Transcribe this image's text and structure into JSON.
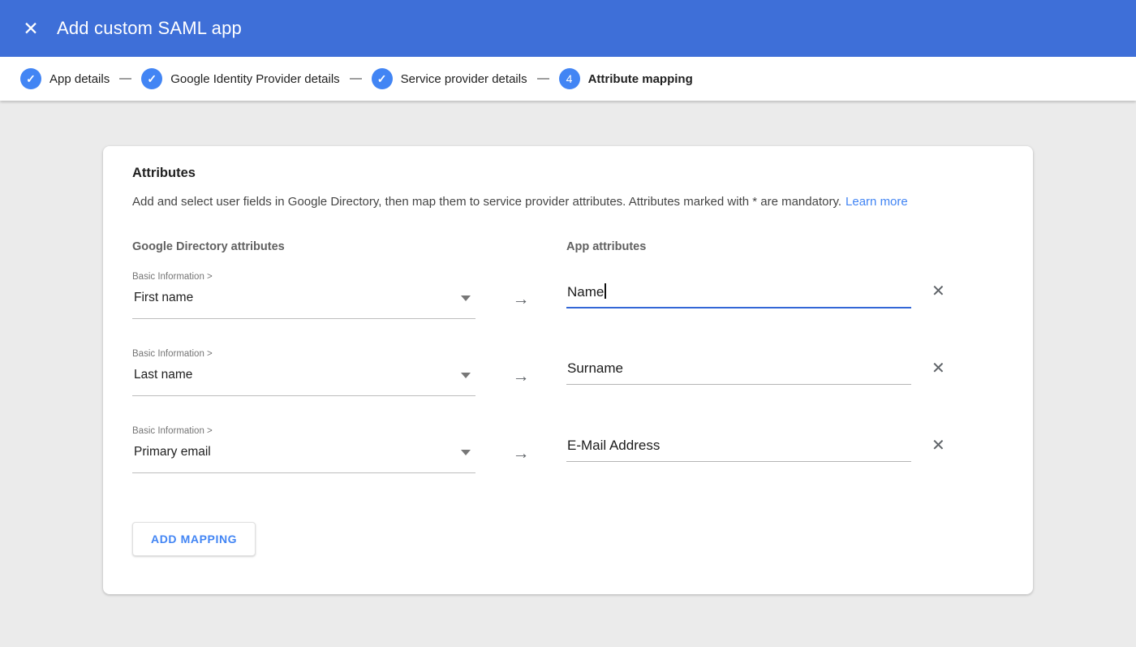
{
  "header": {
    "title": "Add custom SAML app"
  },
  "icons": {
    "close": "✕",
    "check": "✓",
    "arrow_right": "→",
    "delete": "✕"
  },
  "stepper": {
    "steps": [
      {
        "label": "App details",
        "state": "complete"
      },
      {
        "label": "Google Identity Provider details",
        "state": "complete"
      },
      {
        "label": "Service provider details",
        "state": "complete"
      },
      {
        "label": "Attribute mapping",
        "state": "current",
        "number": "4"
      }
    ]
  },
  "card": {
    "section_title": "Attributes",
    "description": "Add and select user fields in Google Directory, then map them to service provider attributes. Attributes marked with * are mandatory.",
    "learn_more_label": "Learn more",
    "columns": {
      "left": "Google Directory attributes",
      "right": "App attributes"
    },
    "mappings": [
      {
        "category": "Basic Information >",
        "field": "First name",
        "app_value": "Name",
        "focused": true
      },
      {
        "category": "Basic Information >",
        "field": "Last name",
        "app_value": "Surname",
        "focused": false
      },
      {
        "category": "Basic Information >",
        "field": "Primary email",
        "app_value": "E-Mail Address",
        "focused": false
      }
    ],
    "add_mapping_label": "ADD MAPPING"
  },
  "colors": {
    "header_bg": "#3e6fd8",
    "step_circle": "#4285f4",
    "link": "#4285f4",
    "focus_underline": "#3367d6"
  }
}
